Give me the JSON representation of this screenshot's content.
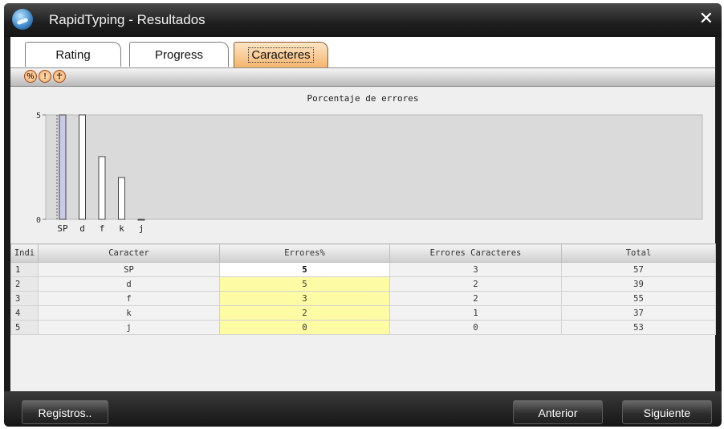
{
  "window": {
    "title": "RapidTyping - Resultados"
  },
  "tabs": [
    {
      "label": "Rating"
    },
    {
      "label": "Progress"
    },
    {
      "label": "Caracteres",
      "active": true
    }
  ],
  "toolbar": {
    "icons": [
      "percent-icon",
      "exclamation-icon",
      "person-icon"
    ],
    "glyphs": [
      "%",
      "!",
      "☥"
    ]
  },
  "chart_data": {
    "type": "bar",
    "title": "Porcentaje de errores",
    "categories": [
      "SP",
      "d",
      "f",
      "k",
      "j"
    ],
    "values": [
      5,
      5,
      3,
      2,
      0
    ],
    "ylim": [
      0,
      5
    ],
    "yticks": [
      "0",
      "5"
    ],
    "selected_index": 0,
    "colors": {
      "bar": "#ffffff",
      "selected_bar": "#c9cae8",
      "plot_bg": "#dadada"
    }
  },
  "table": {
    "columns": [
      "Indi",
      "Caracter",
      "Errores%",
      "Errores Caracteres",
      "Total"
    ],
    "rows": [
      [
        "1",
        "SP",
        "5",
        "3",
        "57"
      ],
      [
        "2",
        "d",
        "5",
        "2",
        "39"
      ],
      [
        "3",
        "f",
        "3",
        "2",
        "55"
      ],
      [
        "4",
        "k",
        "2",
        "1",
        "37"
      ],
      [
        "5",
        "j",
        "0",
        "0",
        "53"
      ]
    ],
    "selected_row": 0
  },
  "footer": {
    "records": "Registros..",
    "previous": "Anterior",
    "next": "Siguiente"
  }
}
